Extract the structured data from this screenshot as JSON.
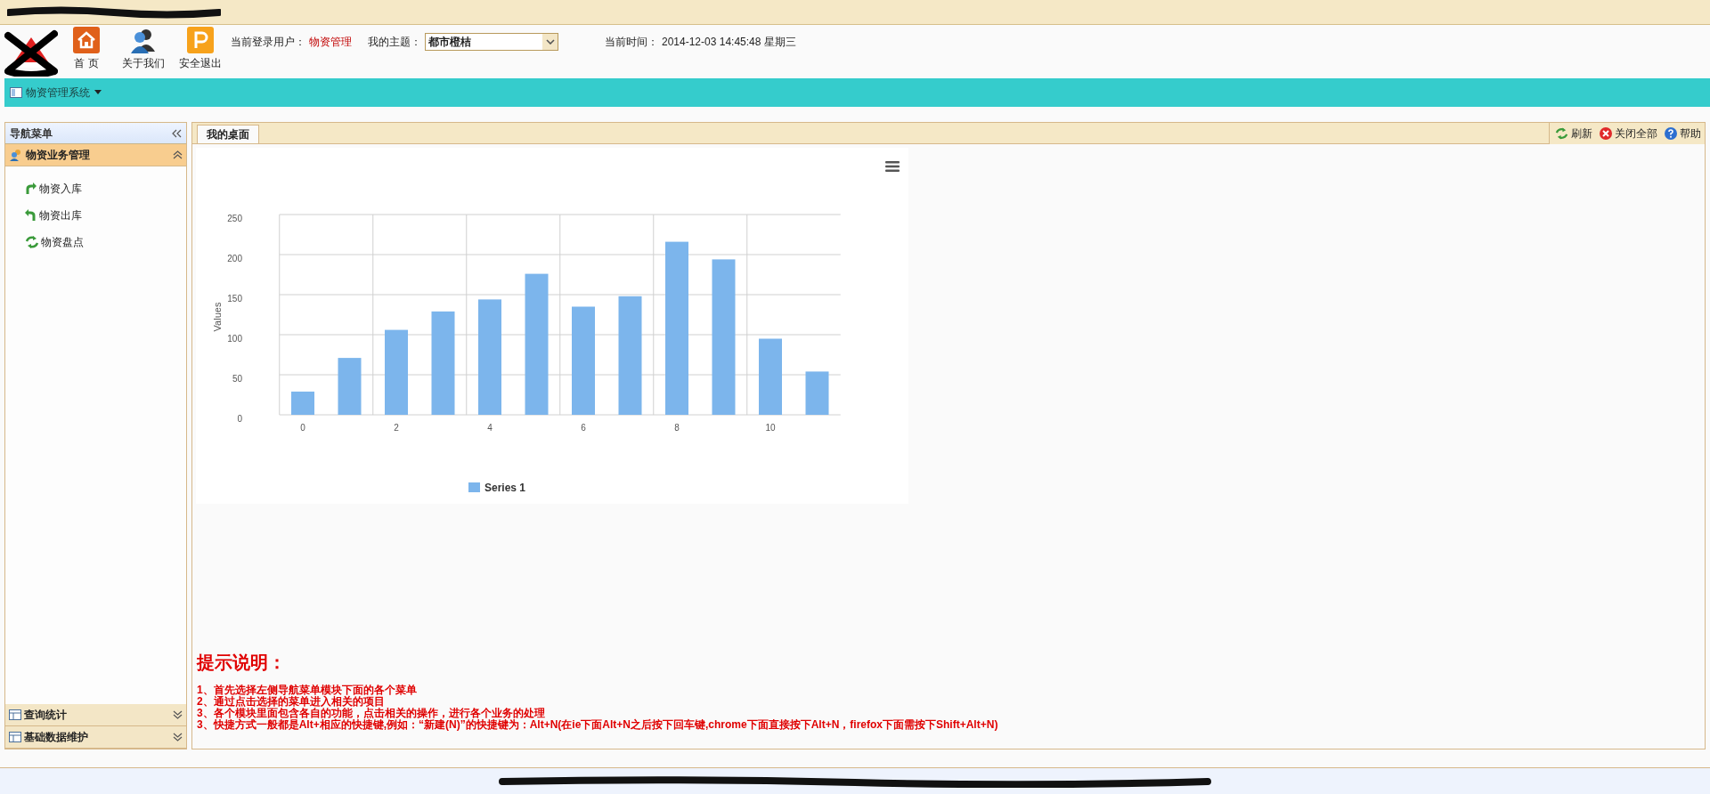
{
  "header": {
    "nav_buttons": [
      {
        "kind": "home",
        "label": "首 页"
      },
      {
        "kind": "about",
        "label": "关于我们"
      },
      {
        "kind": "logout",
        "label": "安全退出"
      }
    ],
    "user_label": "当前登录用户：",
    "user_name": "物资管理",
    "theme_label": "我的主题：",
    "theme_value": "都市橙桔",
    "time_label": "当前时间：",
    "time_value": "2014-12-03 14:45:48 星期三"
  },
  "menubar": {
    "system": "物资管理系统"
  },
  "sidebar": {
    "title": "导航菜单",
    "groups": [
      {
        "label": "物资业务管理",
        "expanded": true,
        "items": [
          {
            "kind": "in",
            "label": "物资入库"
          },
          {
            "kind": "out",
            "label": "物资出库"
          },
          {
            "kind": "check",
            "label": "物资盘点"
          }
        ]
      },
      {
        "label": "查询统计",
        "expanded": false
      },
      {
        "label": "基础数据维护",
        "expanded": false
      }
    ]
  },
  "tabs": [
    {
      "label": "我的桌面",
      "selected": true
    }
  ],
  "toolbar": [
    {
      "kind": "refresh",
      "label": "刷新"
    },
    {
      "kind": "close",
      "label": "关闭全部"
    },
    {
      "kind": "help",
      "label": "帮助"
    }
  ],
  "chart_data": {
    "type": "bar",
    "ylabel": "Values",
    "x": [
      0,
      1,
      2,
      3,
      4,
      5,
      6,
      7,
      8,
      9,
      10,
      11
    ],
    "series": [
      {
        "name": "Series 1",
        "color": "#7cb5ec",
        "values": [
          29,
          71,
          106,
          129,
          144,
          176,
          135,
          148,
          216,
          194,
          95,
          54
        ]
      }
    ],
    "grid": true,
    "xlim": [
      -0.5,
      11.5
    ],
    "ylim": [
      0,
      250
    ],
    "yticks": [
      {
        "value": 0,
        "label": "0"
      },
      {
        "value": 50,
        "label": "50"
      },
      {
        "value": 100,
        "label": "100"
      },
      {
        "value": 150,
        "label": "150"
      },
      {
        "value": 200,
        "label": "200"
      },
      {
        "value": 250,
        "label": "250"
      }
    ],
    "xticks": [
      {
        "value": 0,
        "label": "0"
      },
      {
        "value": 2,
        "label": "2"
      },
      {
        "value": 4,
        "label": "4"
      },
      {
        "value": 6,
        "label": "6"
      },
      {
        "value": 8,
        "label": "8"
      },
      {
        "value": 10,
        "label": "10"
      }
    ]
  },
  "hints": {
    "title": "提示说明：",
    "lines": [
      "1、首先选择左侧导航菜单模块下面的各个菜单",
      "2、通过点击选择的菜单进入相关的项目",
      "3、各个模块里面包含各自的功能，点击相关的操作，进行各个业务的处理",
      "3、快捷方式一般都是Alt+相应的快捷键,例如：“新建(N)”的快捷键为：Alt+N(在ie下面Alt+N之后按下回车键,chrome下面直接按下Alt+N，firefox下面需按下Shift+Alt+N)"
    ]
  }
}
